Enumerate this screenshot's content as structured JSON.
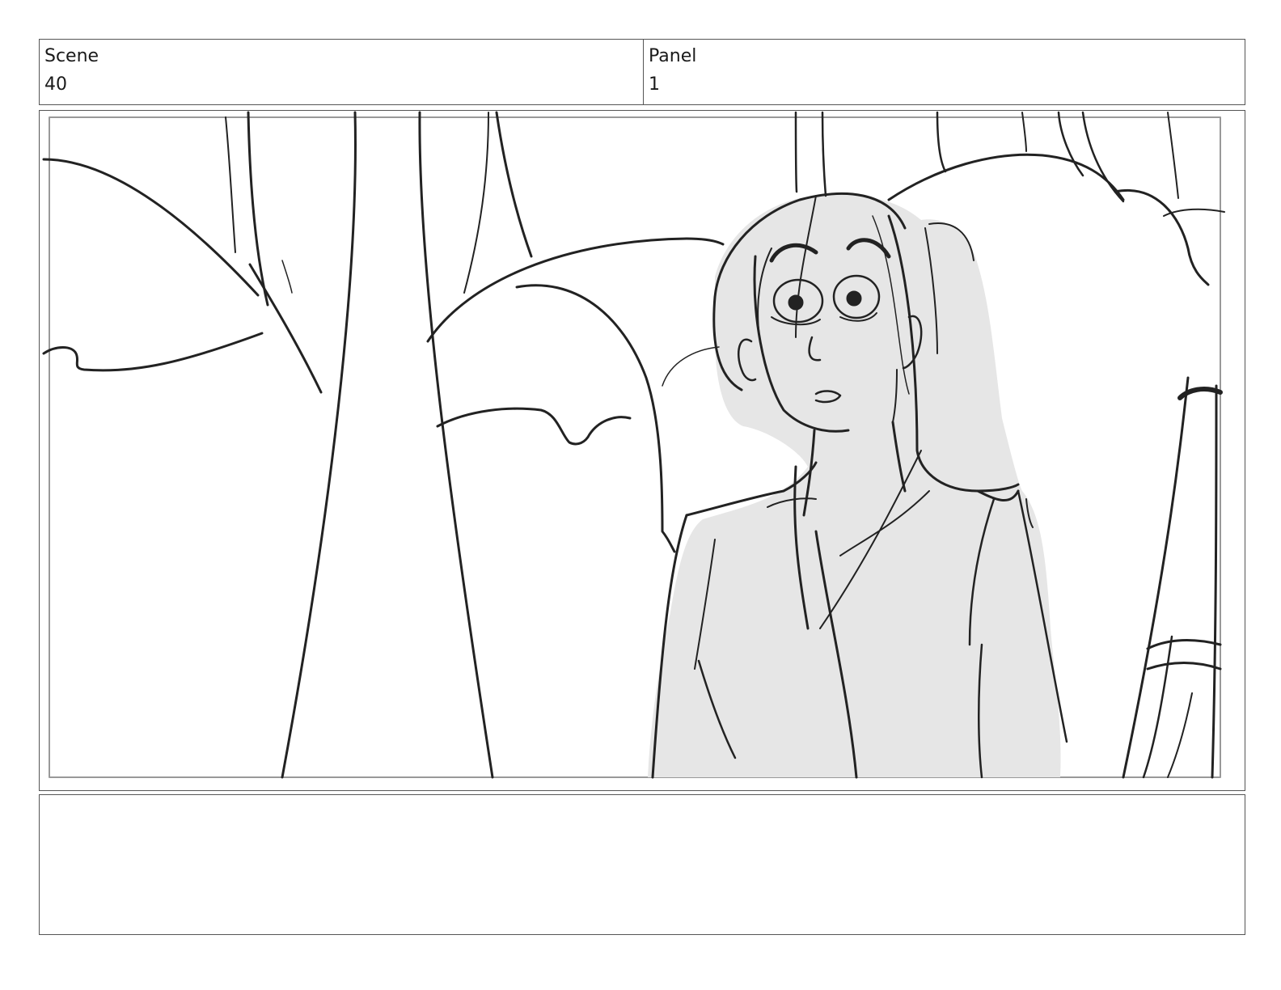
{
  "header": {
    "scene_label": "Scene",
    "scene_value": "40",
    "panel_label": "Panel",
    "panel_value": "1"
  },
  "notes": {
    "text": ""
  }
}
